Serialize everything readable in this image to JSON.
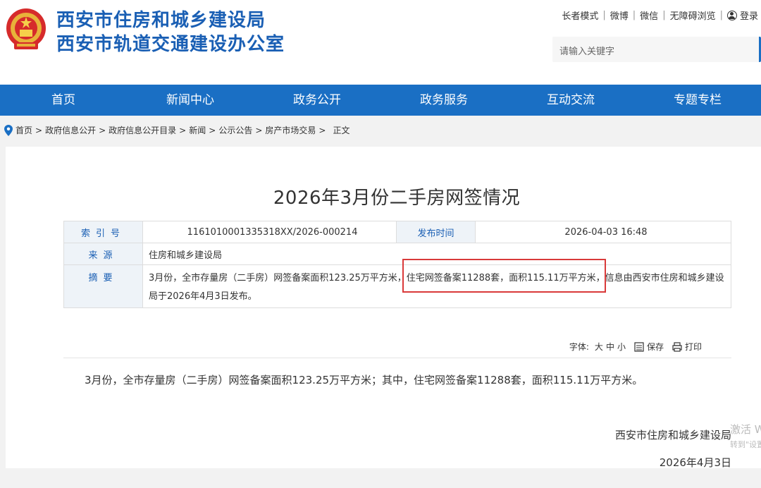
{
  "header": {
    "title_line1": "西安市住房和城乡建设局",
    "title_line2": "西安市轨道交通建设办公室",
    "links": [
      "长者模式",
      "微博",
      "微信",
      "无障碍浏览"
    ],
    "login": "登录",
    "search_placeholder": "请输入关键字"
  },
  "nav": [
    "首页",
    "新闻中心",
    "政务公开",
    "政务服务",
    "互动交流",
    "专题专栏"
  ],
  "breadcrumb": [
    "首页",
    "政府信息公开",
    "政府信息公开目录",
    "新闻",
    "公示公告",
    "房产市场交易",
    "正文"
  ],
  "article": {
    "title": "2026年3月份二手房网签情况",
    "meta": {
      "index_label": "索引号",
      "index_value": "1161010001335318XX/2026-000214",
      "date_label": "发布时间",
      "date_value": "2026-04-03 16:48",
      "source_label": "来源",
      "source_value": "住房和城乡建设局",
      "summary_label": "摘要",
      "summary_value": "3月份，全市存量房（二手房）网签备案面积123.25万平方米，住宅网签备案11288套，面积115.11万平方米，信息由西安市住房和城乡建设局于2026年4月3日发布。"
    },
    "tools": {
      "font_label": "字体:",
      "sizes": [
        "大",
        "中",
        "小"
      ],
      "save": "保存",
      "print": "打印"
    },
    "body": "3月份，全市存量房（二手房）网签备案面积123.25万平方米；其中，住宅网签备案11288套，面积115.11万平方米。",
    "sign_org": "西安市住房和城乡建设局",
    "sign_date": "2026年4月3日"
  },
  "overlay": {
    "line1": "激活 W",
    "line2": "转到\"设置"
  },
  "colors": {
    "brand_blue": "#1a6fc4",
    "title_blue": "#1a5fb4",
    "highlight_red": "#d93a3a"
  }
}
